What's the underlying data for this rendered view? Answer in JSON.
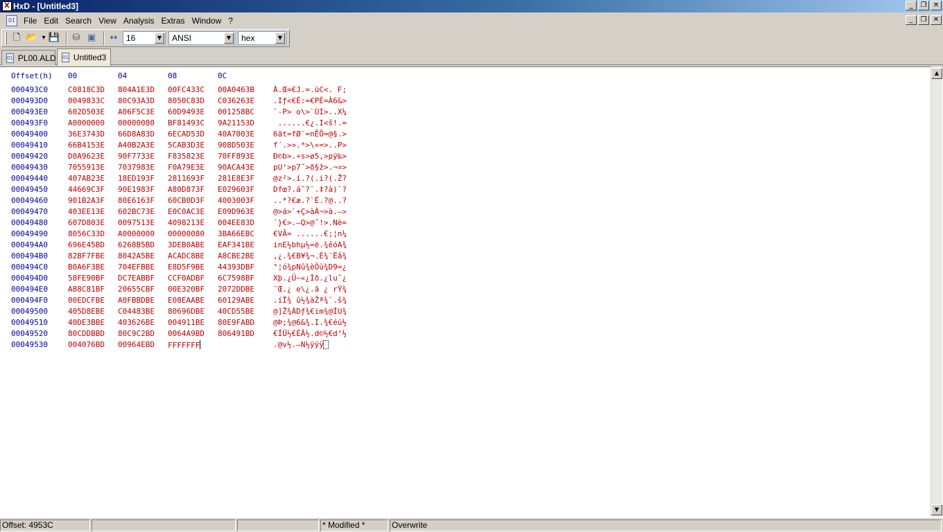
{
  "window": {
    "title": "HxD - [Untitled3]",
    "app_icon_glyph": "X",
    "controls": {
      "minimize": "_",
      "maximize": "❐",
      "close": "✕"
    }
  },
  "menu": {
    "doc_icon_glyph": "01",
    "items": [
      "File",
      "Edit",
      "Search",
      "View",
      "Analysis",
      "Extras",
      "Window",
      "?"
    ]
  },
  "toolbar": {
    "icons": {
      "new": "🗋",
      "open": "📂",
      "open_dropdown": "▾",
      "save": "💾",
      "disk": "⛁",
      "ram": "▣",
      "bytes_per_row": "↔"
    },
    "bytes_per_row": "16",
    "charset": "ANSI",
    "offset_base": "hex",
    "dropdown_arrow": "▼"
  },
  "tabs": [
    {
      "label": "PL00.ALD",
      "active": false
    },
    {
      "label": "Untitled3",
      "active": true
    }
  ],
  "hex": {
    "header": {
      "offset": "Offset(h)",
      "cols": [
        "00",
        "04",
        "08",
        "0C"
      ]
    },
    "rows": [
      {
        "offset": "000493C0",
        "g": [
          "C0818C3D",
          "804A1E3D",
          "00FC433C",
          "00A0463B"
        ],
        "text": "À.Œ=€J.=.üC<. F;"
      },
      {
        "offset": "000493D0",
        "g": [
          "0049833C",
          "80C93A3D",
          "8050C83D",
          "C036263E"
        ],
        "text": ".Iƒ<€É:=€PÈ=À6&>"
      },
      {
        "offset": "000493E0",
        "g": [
          "602D503E",
          "A06F5C3E",
          "60D9493E",
          "001258BC"
        ],
        "text": "`-P> o\\>`ÙI>..X¼"
      },
      {
        "offset": "000493F0",
        "g": [
          "A0000000",
          "00000080",
          "BF81493C",
          "9A21153D"
        ],
        "text": " ......€¿.I<š!.="
      },
      {
        "offset": "00049400",
        "g": [
          "36E3743D",
          "66D8A83D",
          "6ECAD53D",
          "40A7003E"
        ],
        "text": "6ãt=fØ¨=nÊÕ=@§.>"
      },
      {
        "offset": "00049410",
        "g": [
          "66B4153E",
          "A40B2A3E",
          "5CAB3D3E",
          "908D503E"
        ],
        "text": "f´.>¤.*>\\«=>..P>"
      },
      {
        "offset": "00049420",
        "g": [
          "D0A9623E",
          "90F7733E",
          "F835823E",
          "70FF893E"
        ],
        "text": "Ð©b>.÷s>ø5‚>pÿ‰>"
      },
      {
        "offset": "00049430",
        "g": [
          "7055913E",
          "7037983E",
          "F0A79E3E",
          "90ACA43E"
        ],
        "text": "pU‘>p7˜>ð§ž>.¬¤>"
      },
      {
        "offset": "00049440",
        "g": [
          "407AB23E",
          "18ED193F",
          "2811693F",
          "281E8E3F"
        ],
        "text": "@z²>.í.?(.i?(.Ž?"
      },
      {
        "offset": "00049450",
        "g": [
          "44669C3F",
          "90E1983F",
          "A80D873F",
          "E029603F"
        ],
        "text": "Dfœ?.á˜?¨.‡?à)`?"
      },
      {
        "offset": "00049460",
        "g": [
          "901B2A3F",
          "80E6163F",
          "60CB0D3F",
          "4003003F"
        ],
        "text": "..*?€æ.?`Ë.?@..?"
      },
      {
        "offset": "00049470",
        "g": [
          "403EE13E",
          "602BC73E",
          "E0C0AC3E",
          "E09D963E"
        ],
        "text": "@>á>`+Ç>àÀ¬>à.–>"
      },
      {
        "offset": "00049480",
        "g": [
          "607D803E",
          "0097513E",
          "4098213E",
          "004EE83D"
        ],
        "text": "`}€>.—Q>@˜!>.Nè="
      },
      {
        "offset": "00049490",
        "g": [
          "8056C33D",
          "A0000000",
          "00000080",
          "3BA66EBC"
        ],
        "text": "€VÃ= ......€;¦n¼"
      },
      {
        "offset": "000494A0",
        "g": [
          "696E45BD",
          "6268B5BD",
          "3DEB0ABE",
          "EAF341BE"
        ],
        "text": "inE½bhµ½=ë.¾êóA¾"
      },
      {
        "offset": "000494B0",
        "g": [
          "82BF7FBE",
          "8042A5BE",
          "ACADC8BE",
          "A8CBE2BE"
        ],
        "text": "‚¿.¾€B¥¾¬.È¾¨Ëâ¾"
      },
      {
        "offset": "000494C0",
        "g": [
          "B0A6F3BE",
          "704EFBBE",
          "E8D5F9BE",
          "44393DBF"
        ],
        "text": "°¦ó¾pNû¾èÕù¾D9=¿"
      },
      {
        "offset": "000494D0",
        "g": [
          "58FE90BF",
          "DC7EABBF",
          "CCF0ADBF",
          "6C7598BF"
        ],
        "text": "Xþ.¿Ü~«¿Ìð.¿lu˜¿"
      },
      {
        "offset": "000494E0",
        "g": [
          "A88C81BF",
          "20655CBF",
          "00E320BF",
          "2072DDBE"
        ],
        "text": "¨Œ.¿ e\\¿.ã ¿ rÝ¾"
      },
      {
        "offset": "000494F0",
        "g": [
          "00EDCFBE",
          "A0FBBDBE",
          "E08EAABE",
          "60129ABE"
        ],
        "text": ".íÏ¾ û½¾àŽª¾`.š¾"
      },
      {
        "offset": "00049500",
        "g": [
          "405D8EBE",
          "C04483BE",
          "80696DBE",
          "40CD55BE"
        ],
        "text": "@]Ž¾ÀDƒ¾€im¾@ÍU¾"
      },
      {
        "offset": "00049510",
        "g": [
          "40DE3BBE",
          "403626BE",
          "004911BE",
          "80E9FABD"
        ],
        "text": "@Þ;¾@6&¾.I.¾€éú½"
      },
      {
        "offset": "00049520",
        "g": [
          "80CDDBBD",
          "80C9C2BD",
          "0064A9BD",
          "806491BD"
        ],
        "text": "€ÍÛ½€ÉÂ½.d©½€d‘½"
      },
      {
        "offset": "00049530",
        "g": [
          "004076BD",
          "00964EBD",
          "FFFFFFF",
          ""
        ],
        "text": ".@v½.–N½ÿÿÿ"
      }
    ]
  },
  "scrollbar": {
    "up": "▲",
    "down": "▼"
  },
  "status": {
    "offset": "Offset: 4953C",
    "cell2": "",
    "cell3": "",
    "modified": "* Modified *",
    "mode": "Overwrite"
  }
}
